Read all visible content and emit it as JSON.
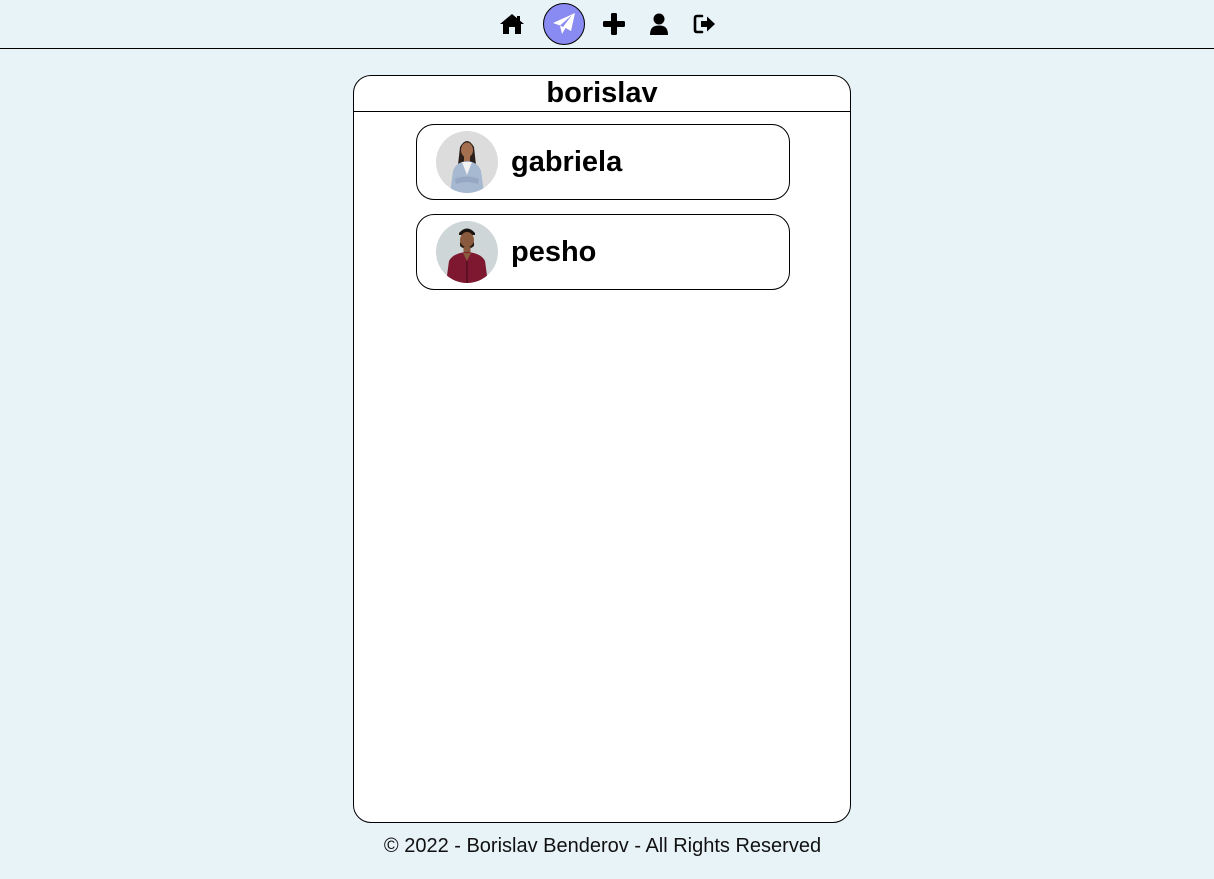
{
  "nav": {
    "items": [
      {
        "name": "home",
        "icon": "home-icon"
      },
      {
        "name": "messages",
        "icon": "paper-plane-icon",
        "active": true
      },
      {
        "name": "create",
        "icon": "plus-icon"
      },
      {
        "name": "profile",
        "icon": "user-icon"
      },
      {
        "name": "logout",
        "icon": "sign-out-icon"
      }
    ],
    "accent_color": "#8a8af3"
  },
  "panel": {
    "title": "borislav",
    "contacts": [
      {
        "name": "gabriela",
        "avatar": "avatar-woman"
      },
      {
        "name": "pesho",
        "avatar": "avatar-man"
      }
    ]
  },
  "footer": {
    "text": "© 2022 - Borislav Benderov - All Rights Reserved"
  }
}
